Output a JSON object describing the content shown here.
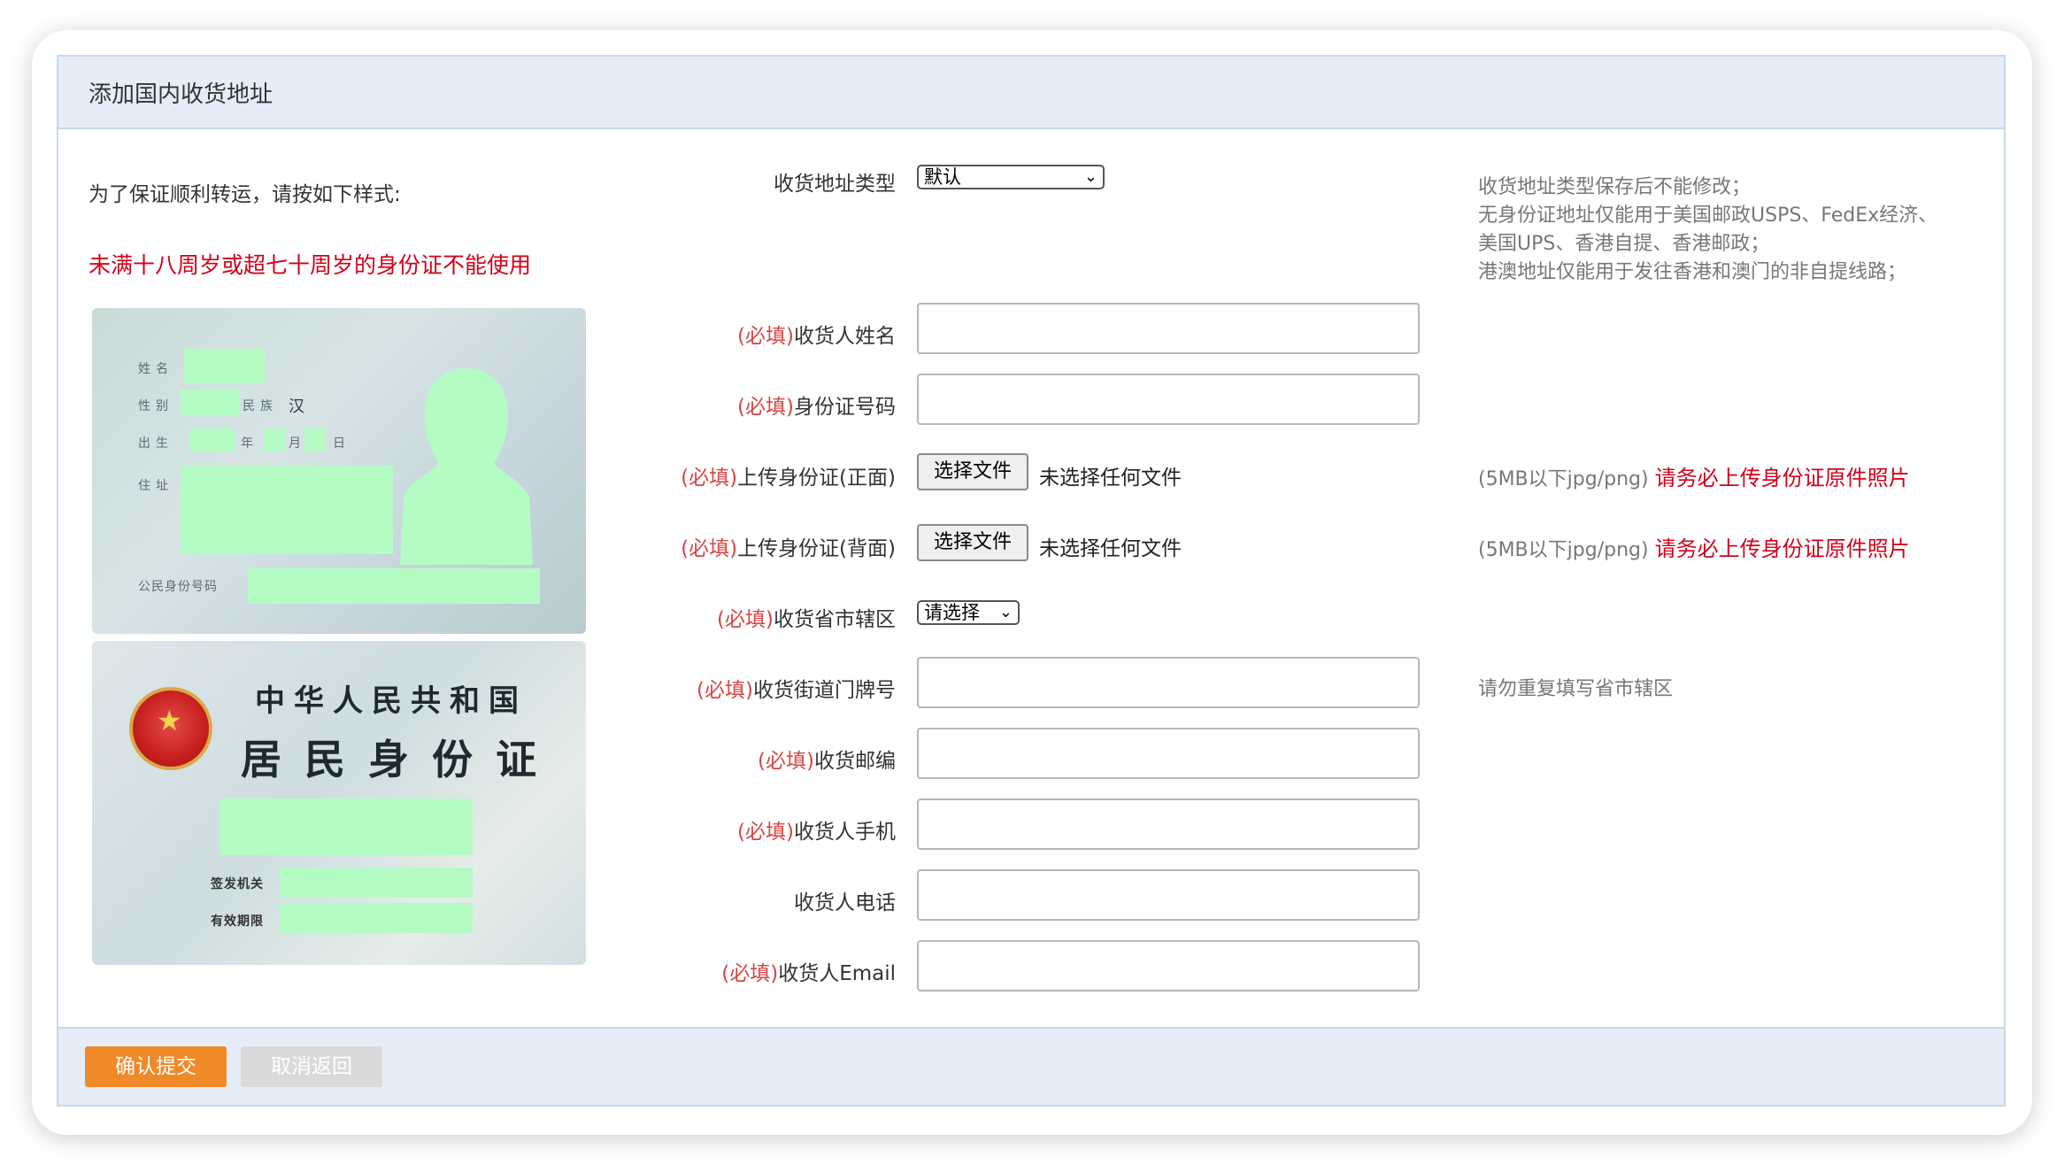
{
  "panel": {
    "title": "添加国内收货地址"
  },
  "left": {
    "note": "为了保证顺利转运，请按如下样式:",
    "warning": "未满十八周岁或超七十周岁的身份证不能使用"
  },
  "id_card_front": {
    "label_name": "姓名",
    "label_gender": "性别",
    "label_ethnicity": "民族",
    "ethnicity_value": "汉",
    "label_birth": "出生",
    "label_year": "年",
    "label_month": "月",
    "label_day": "日",
    "label_address": "住址",
    "label_id_number": "公民身份号码"
  },
  "id_card_back": {
    "title_line1": "中华人民共和国",
    "title_line2": "居民身份证",
    "label_authority": "签发机关",
    "label_validity": "有效期限"
  },
  "form": {
    "required_prefix": "(必填)",
    "address_type": {
      "label": "收货地址类型",
      "selected": "默认"
    },
    "address_type_hint": [
      "收货地址类型保存后不能修改；",
      "无身份证地址仅能用于美国邮政USPS、FedEx经济、",
      "美国UPS、香港自提、香港邮政；",
      "港澳地址仅能用于发往香港和澳门的非自提线路；"
    ],
    "receiver_name": {
      "label": "收货人姓名"
    },
    "id_number": {
      "label": "身份证号码"
    },
    "id_front": {
      "label": "上传身份证(正面)"
    },
    "id_back": {
      "label": "上传身份证(背面)"
    },
    "file_button": "选择文件",
    "file_status": "未选择任何文件",
    "upload_hint_size": "(5MB以下jpg/png)",
    "upload_hint_warning": "请务必上传身份证原件照片",
    "region": {
      "label": "收货省市辖区",
      "selected": "请选择"
    },
    "street": {
      "label": "收货街道门牌号",
      "hint": "请勿重复填写省市辖区"
    },
    "postcode": {
      "label": "收货邮编"
    },
    "mobile": {
      "label": "收货人手机"
    },
    "phone": {
      "label": "收货人电话"
    },
    "email": {
      "label": "收货人Email"
    }
  },
  "footer": {
    "submit": "确认提交",
    "cancel": "取消返回"
  },
  "colors": {
    "accent": "#f08a28",
    "required": "#d64545",
    "warning": "#d0021b",
    "header_bg": "#e5eef8"
  }
}
